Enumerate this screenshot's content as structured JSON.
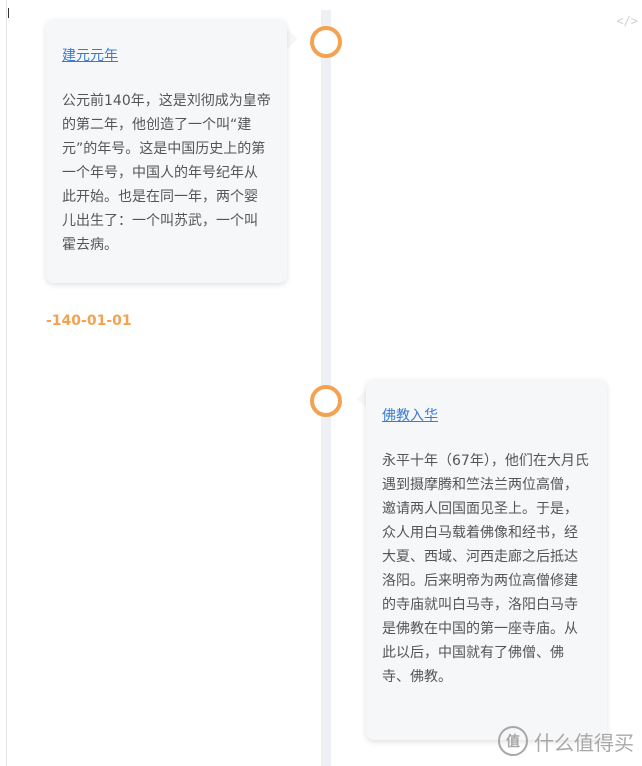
{
  "timeline": {
    "events": [
      {
        "title": "建元元年",
        "body": "公元前140年，这是刘彻成为皇帝的第二年，他创造了一个叫“建元”的年号。这是中国历史上的第一个年号，中国人的年号纪年从此开始。也是在同一年，两个婴儿出生了：一个叫苏武，一个叫霍去病。",
        "date": "-140-01-01"
      },
      {
        "title": "佛教入华",
        "body": "永平十年（67年），他们在大月氏遇到摄摩腾和竺法兰两位高僧，邀请两人回国面见圣上。于是，众人用白马载着佛像和经书，经大夏、西域、河西走廊之后抵达洛阳。后来明帝为两位高僧修建的寺庙就叫白马寺，洛阳白马寺是佛教在中国的第一座寺庙。从此以后，中国就有了佛僧、佛寺、佛教。"
      }
    ]
  },
  "watermark": {
    "logo_text": "值",
    "text": "什么值得买"
  },
  "toolbar": {
    "code_icon": "</>"
  },
  "colors": {
    "accent": "#f3a251",
    "link": "#3c7ad1",
    "card_bg": "#f6f7f9",
    "axis": "#eef0f3"
  }
}
